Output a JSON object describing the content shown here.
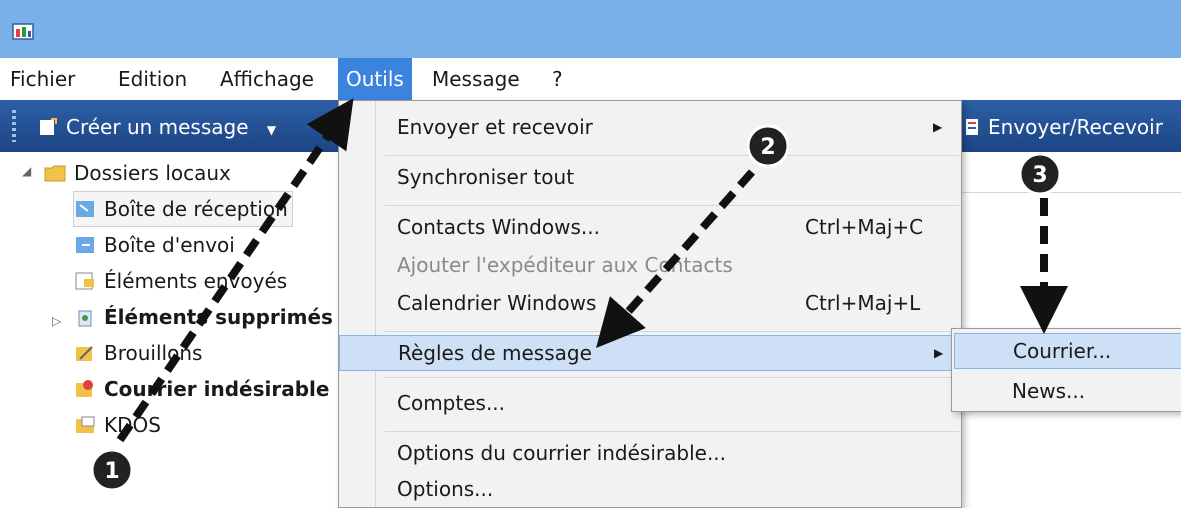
{
  "menubar": {
    "items": [
      "Fichier",
      "Edition",
      "Affichage",
      "Outils",
      "Message",
      "?"
    ],
    "active": "Outils"
  },
  "toolbar": {
    "create_message": "Créer un message",
    "send_receive": "Envoyer/Recevoir"
  },
  "folders": {
    "root": "Dossiers locaux",
    "items": [
      "Boîte de réception",
      "Boîte d'envoi",
      "Éléments envoyés",
      "Éléments supprimés",
      "Brouillons",
      "Courrier indésirable",
      "KDOS"
    ]
  },
  "tools_menu": {
    "items": [
      {
        "label": "Envoyer et recevoir"
      },
      {
        "label": "Synchroniser tout"
      },
      {
        "label": "Contacts Windows...",
        "shortcut": "Ctrl+Maj+C"
      },
      {
        "label": "Ajouter l'expéditeur aux Contacts"
      },
      {
        "label": "Calendrier Windows",
        "shortcut": "Ctrl+Maj+L"
      },
      {
        "label": "Règles de message"
      },
      {
        "label": "Comptes..."
      },
      {
        "label": "Options du courrier indésirable..."
      },
      {
        "label": "Options..."
      }
    ]
  },
  "rules_submenu": {
    "items": [
      "Courrier...",
      "News..."
    ]
  },
  "annotations": {
    "steps": [
      "1",
      "2",
      "3"
    ]
  },
  "colors": {
    "titlebar": "#7ab0e8",
    "menu_active": "#3a84e0",
    "toolbar": "#1c4585",
    "highlight": "#cde0f5"
  }
}
